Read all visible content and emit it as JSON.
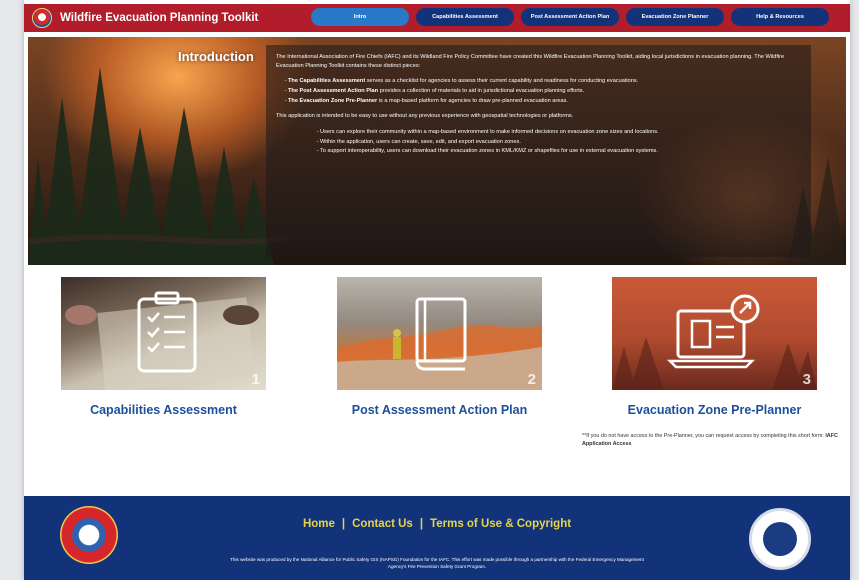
{
  "header": {
    "title": "Wildfire Evacuation Planning Toolkit",
    "nav": [
      {
        "label": "Intro",
        "active": true
      },
      {
        "label": "Capabilities Assessment",
        "active": false
      },
      {
        "label": "Post Assessment Action Plan",
        "active": false
      },
      {
        "label": "Evacuation Zone Planner",
        "active": false
      },
      {
        "label": "Help & Resources",
        "active": false
      }
    ],
    "colors": {
      "bar": "#b11d2b",
      "nav": "#12337a",
      "nav_active": "#2a79c8"
    }
  },
  "hero": {
    "title": "Introduction",
    "intro": "The International Association of Fire Chiefs (IAFC) and its Wildland Fire Policy Committee have created this Wildfire Evacuation Planning Toolkit, aiding local jurisdictions in evacuation planning. The Wildfire Evacuation Planning Toolkit contains these distinct pieces:",
    "pieces": [
      {
        "name": "The Capabilities Assessment",
        "text": " serves as a checklist for agencies to assess their current capability and readiness for conducting evacuations."
      },
      {
        "name": "The Post Assessment Action Plan",
        "text": " provides a collection of materials to aid in jurisdictional evacuation planning efforts."
      },
      {
        "name": "The Evacuation Zone Pre-Planner",
        "text": " is a map-based platform for agencies to draw pre-planned evacuation areas."
      }
    ],
    "app_intro": "This application is intended to be easy to use without any previous experience with geospatial technologies or platforms.",
    "app_points": [
      "Users can explore their community within a map-based environment to make informed decisions on evacuation zone sizes and locations.",
      "Within the application, users can create, save, edit, and export evacuation zones.",
      "To support interoperability, users can download their evacuation zones in KML/KMZ or shapefiles for use in external evacuation systems."
    ]
  },
  "cards": [
    {
      "title": "Capabilities Assessment",
      "number": "1",
      "icon": "checklist-icon"
    },
    {
      "title": "Post Assessment Action Plan",
      "number": "2",
      "icon": "book-icon"
    },
    {
      "title": "Evacuation Zone Pre-Planner",
      "number": "3",
      "icon": "map-planner-icon"
    }
  ],
  "note": {
    "text": "**If you do not have access to the Pre-Planner, you can request access by completing this short form: ",
    "link": "IAFC Application Access"
  },
  "footer": {
    "links": [
      "Home",
      "Contact Us",
      "Terms of Use & Copyright"
    ],
    "separator": "|",
    "credit": "This website was produced by the National Alliance for Public Safety GIS (NAPSG) Foundation for the IAFC. This effort was made possible through a partnership with the Federal Emergency Management Agency's Fire Prevention Safety Grant Program.",
    "colors": {
      "bg": "#12337a",
      "links": "#e7d34a"
    }
  }
}
